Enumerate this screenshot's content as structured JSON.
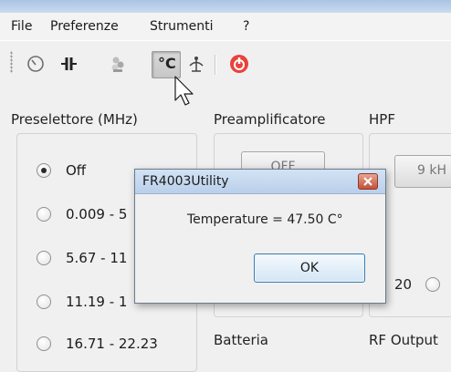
{
  "menu": {
    "file": "File",
    "preferences": "Preferenze",
    "tools": "Strumenti",
    "help": "?"
  },
  "toolbar": {
    "temp_button_label": "°C",
    "items": [
      "clock-icon",
      "capacitor-icon",
      "fan-icon",
      "temperature-icon",
      "antenna-icon",
      "power-icon"
    ]
  },
  "main": {
    "preselector_label": "Preselettore (MHz)",
    "preamp_label": "Preamplificatore",
    "hpf_label": "HPF",
    "preamp_button": "OFF",
    "hpf_button": "9 kH",
    "preselector_options": [
      "Off",
      "0.009 - 5",
      "5.67 - 11",
      "11.19 - 1",
      "16.71 - 22.23"
    ],
    "selected_option": "Off",
    "mid_value": "20",
    "battery_label": "Batteria",
    "rf_output_label": "RF Output"
  },
  "dialog": {
    "title": "FR4003Utility",
    "message": "Temperature = 47.50 C°",
    "ok_label": "OK"
  },
  "colors": {
    "title_band": "#b7cfec",
    "power_icon": "#e8433a",
    "dialog_close": "#c65036",
    "ok_border": "#3c7fb1"
  }
}
